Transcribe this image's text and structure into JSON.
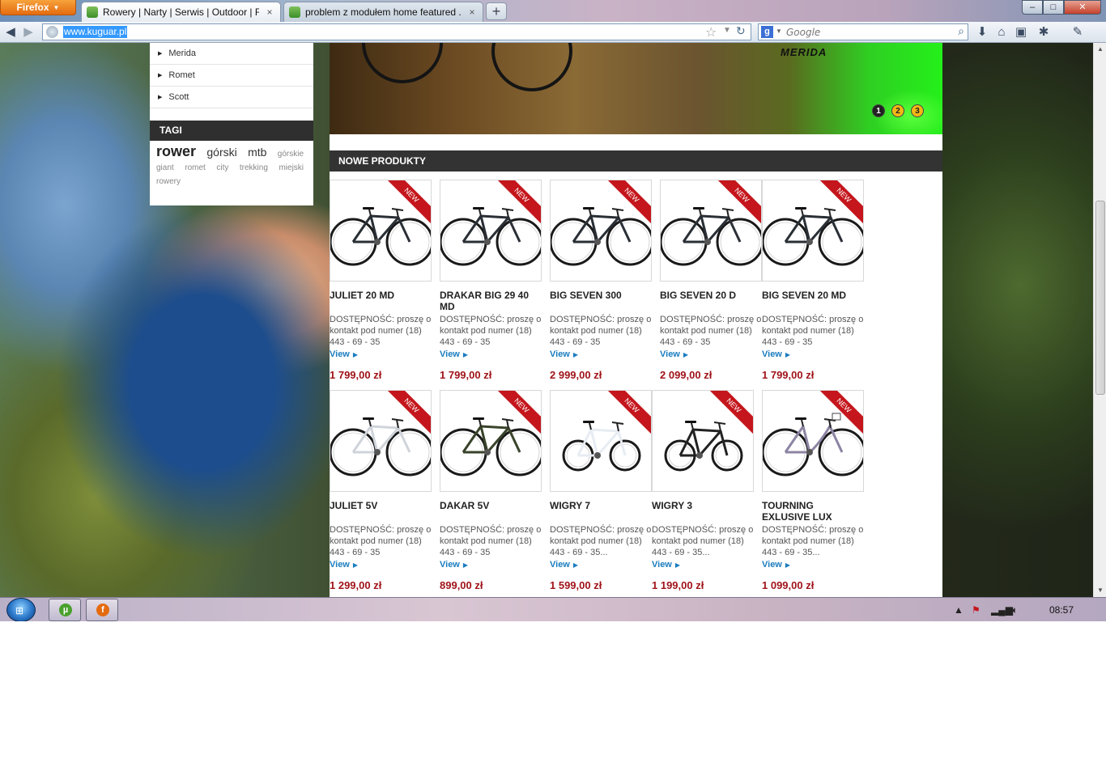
{
  "browser": {
    "menu_label": "Firefox",
    "tabs": [
      {
        "title": "Rowery | Narty | Serwis | Outdoor | Fit...",
        "close": "×",
        "active": true
      },
      {
        "title": "problem z modułem home featured ...",
        "close": "×",
        "active": false
      }
    ],
    "newtab_label": "+",
    "url": "www.kuguar.pl",
    "search_placeholder": "Google",
    "search_engine_letter": "g",
    "window_buttons": {
      "minimize": "–",
      "maximize": "□",
      "close": "✕"
    }
  },
  "sidebar": {
    "categories": [
      "Merida",
      "Romet",
      "Scott"
    ],
    "tags_title": "TAGI",
    "tags": [
      {
        "label": "rower",
        "size": "xl"
      },
      {
        "label": "górski",
        "size": "lg"
      },
      {
        "label": "mtb",
        "size": "lg"
      },
      {
        "label": "górskie",
        "size": "sm"
      },
      {
        "label": "giant",
        "size": "sm"
      },
      {
        "label": "romet",
        "size": "sm"
      },
      {
        "label": "city",
        "size": "sm"
      },
      {
        "label": "trekking",
        "size": "sm"
      },
      {
        "label": "miejski",
        "size": "sm"
      },
      {
        "label": "rowery",
        "size": "sm"
      }
    ]
  },
  "banner": {
    "logo_text": "MERIDA",
    "slides": [
      "1",
      "2",
      "3"
    ],
    "active_slide": 1
  },
  "section_title": "NOWE PRODUKTY",
  "badge_label": "NEW",
  "view_label": "View",
  "products": [
    {
      "name": "JULIET 20 MD",
      "availability": "DOSTĘPNOŚĆ: proszę o kontakt pod numer (18) 443 - 69 - 35",
      "price": "1 799,00 zł",
      "style": "dark"
    },
    {
      "name": "DRAKAR BIG 29 40 MD",
      "availability": "DOSTĘPNOŚĆ: proszę o kontakt pod numer (18) 443 - 69 - 35",
      "price": "1 799,00 zł",
      "style": "dark"
    },
    {
      "name": "BIG SEVEN 300",
      "availability": "DOSTĘPNOŚĆ: proszę o kontakt pod numer (18) 443 - 69 - 35",
      "price": "2 999,00 zł",
      "style": "dark"
    },
    {
      "name": "BIG SEVEN 20 D",
      "availability": "DOSTĘPNOŚĆ: proszę o kontakt pod numer (18) 443 - 69 - 35",
      "price": "2 099,00 zł",
      "style": "dark"
    },
    {
      "name": "BIG SEVEN 20 MD",
      "availability": "DOSTĘPNOŚĆ: proszę o kontakt pod numer (18) 443 - 69 - 35",
      "price": "1 799,00 zł",
      "style": "dark"
    },
    {
      "name": "JULIET 5V",
      "availability": "DOSTĘPNOŚĆ: proszę o kontakt pod numer (18) 443 - 69 - 35",
      "price": "1 299,00 zł",
      "style": "white"
    },
    {
      "name": "DAKAR 5V",
      "availability": "DOSTĘPNOŚĆ: proszę o kontakt pod numer (18) 443 - 69 - 35",
      "price": "899,00 zł",
      "style": "green"
    },
    {
      "name": "WIGRY 7",
      "availability": "DOSTĘPNOŚĆ: proszę o kontakt pod numer (18) 443 - 69 - 35...",
      "price": "1 599,00 zł",
      "style": "folding-white"
    },
    {
      "name": "WIGRY 3",
      "availability": "DOSTĘPNOŚĆ: proszę o kontakt pod numer (18) 443 - 69 - 35...",
      "price": "1 199,00 zł",
      "style": "folding-black"
    },
    {
      "name": "TOURNING EXLUSIVE LUX",
      "availability": "DOSTĘPNOŚĆ: proszę o kontakt pod numer (18) 443 - 69 - 35...",
      "price": "1 099,00 zł",
      "style": "city"
    }
  ],
  "taskbar": {
    "clock": "08:57",
    "apps": [
      {
        "name": "utorrent",
        "letter": "µ",
        "color": "#4aa02c"
      },
      {
        "name": "firefox",
        "letter": "f",
        "color": "#e46b10"
      }
    ]
  },
  "colors": {
    "accent_red": "#c4161c",
    "price_red": "#a0141a",
    "link_blue": "#1a7cbf"
  }
}
